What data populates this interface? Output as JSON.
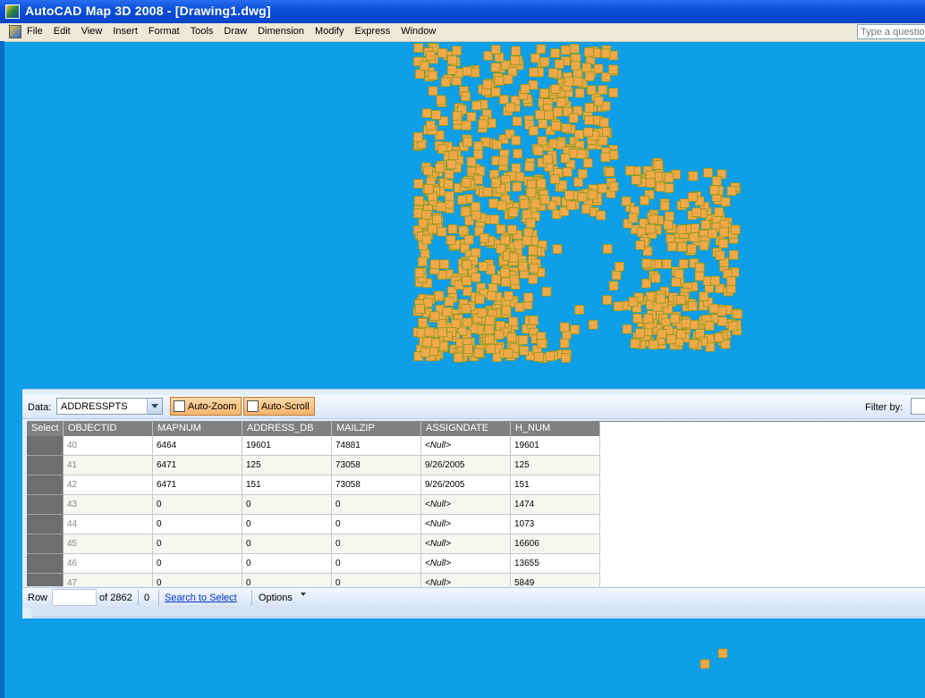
{
  "window": {
    "title": "AutoCAD Map 3D 2008 - [Drawing1.dwg]",
    "help_placeholder": "Type a question"
  },
  "menu": [
    "File",
    "Edit",
    "View",
    "Insert",
    "Format",
    "Tools",
    "Draw",
    "Dimension",
    "Modify",
    "Express",
    "Window"
  ],
  "colors": {
    "canvas": "#0f9ee8",
    "point_fill": "#f0a848",
    "point_stroke": "#8a9a20"
  },
  "data_panel": {
    "data_label": "Data:",
    "data_source": "ADDRESSPTS",
    "auto_zoom": "Auto-Zoom",
    "auto_scroll": "Auto-Scroll",
    "filter_label": "Filter by:",
    "columns": [
      "Select",
      "OBJECTID",
      "MAPNUM",
      "ADDRESS_DB",
      "MAILZIP",
      "ASSIGNDATE",
      "H_NUM"
    ],
    "rows": [
      {
        "objectid": "40",
        "mapnum": "6464",
        "address_db": "19601",
        "mailzip": "74881",
        "assigndate": "<Null>",
        "h_num": "19601"
      },
      {
        "objectid": "41",
        "mapnum": "6471",
        "address_db": "125",
        "mailzip": "73058",
        "assigndate": "9/26/2005",
        "h_num": "125"
      },
      {
        "objectid": "42",
        "mapnum": "6471",
        "address_db": "151",
        "mailzip": "73058",
        "assigndate": "9/26/2005",
        "h_num": "151"
      },
      {
        "objectid": "43",
        "mapnum": "0",
        "address_db": "0",
        "mailzip": "0",
        "assigndate": "<Null>",
        "h_num": "1474"
      },
      {
        "objectid": "44",
        "mapnum": "0",
        "address_db": "0",
        "mailzip": "0",
        "assigndate": "<Null>",
        "h_num": "1073"
      },
      {
        "objectid": "45",
        "mapnum": "0",
        "address_db": "0",
        "mailzip": "0",
        "assigndate": "<Null>",
        "h_num": "16606"
      },
      {
        "objectid": "46",
        "mapnum": "0",
        "address_db": "0",
        "mailzip": "0",
        "assigndate": "<Null>",
        "h_num": "13655"
      },
      {
        "objectid": "47",
        "mapnum": "0",
        "address_db": "0",
        "mailzip": "0",
        "assigndate": "<Null>",
        "h_num": "5849"
      }
    ],
    "status": {
      "row_label": "Row",
      "row_value": "",
      "of_total": "of 2862",
      "selected_count": "0",
      "search_link": "Search to Select",
      "options": "Options"
    }
  }
}
